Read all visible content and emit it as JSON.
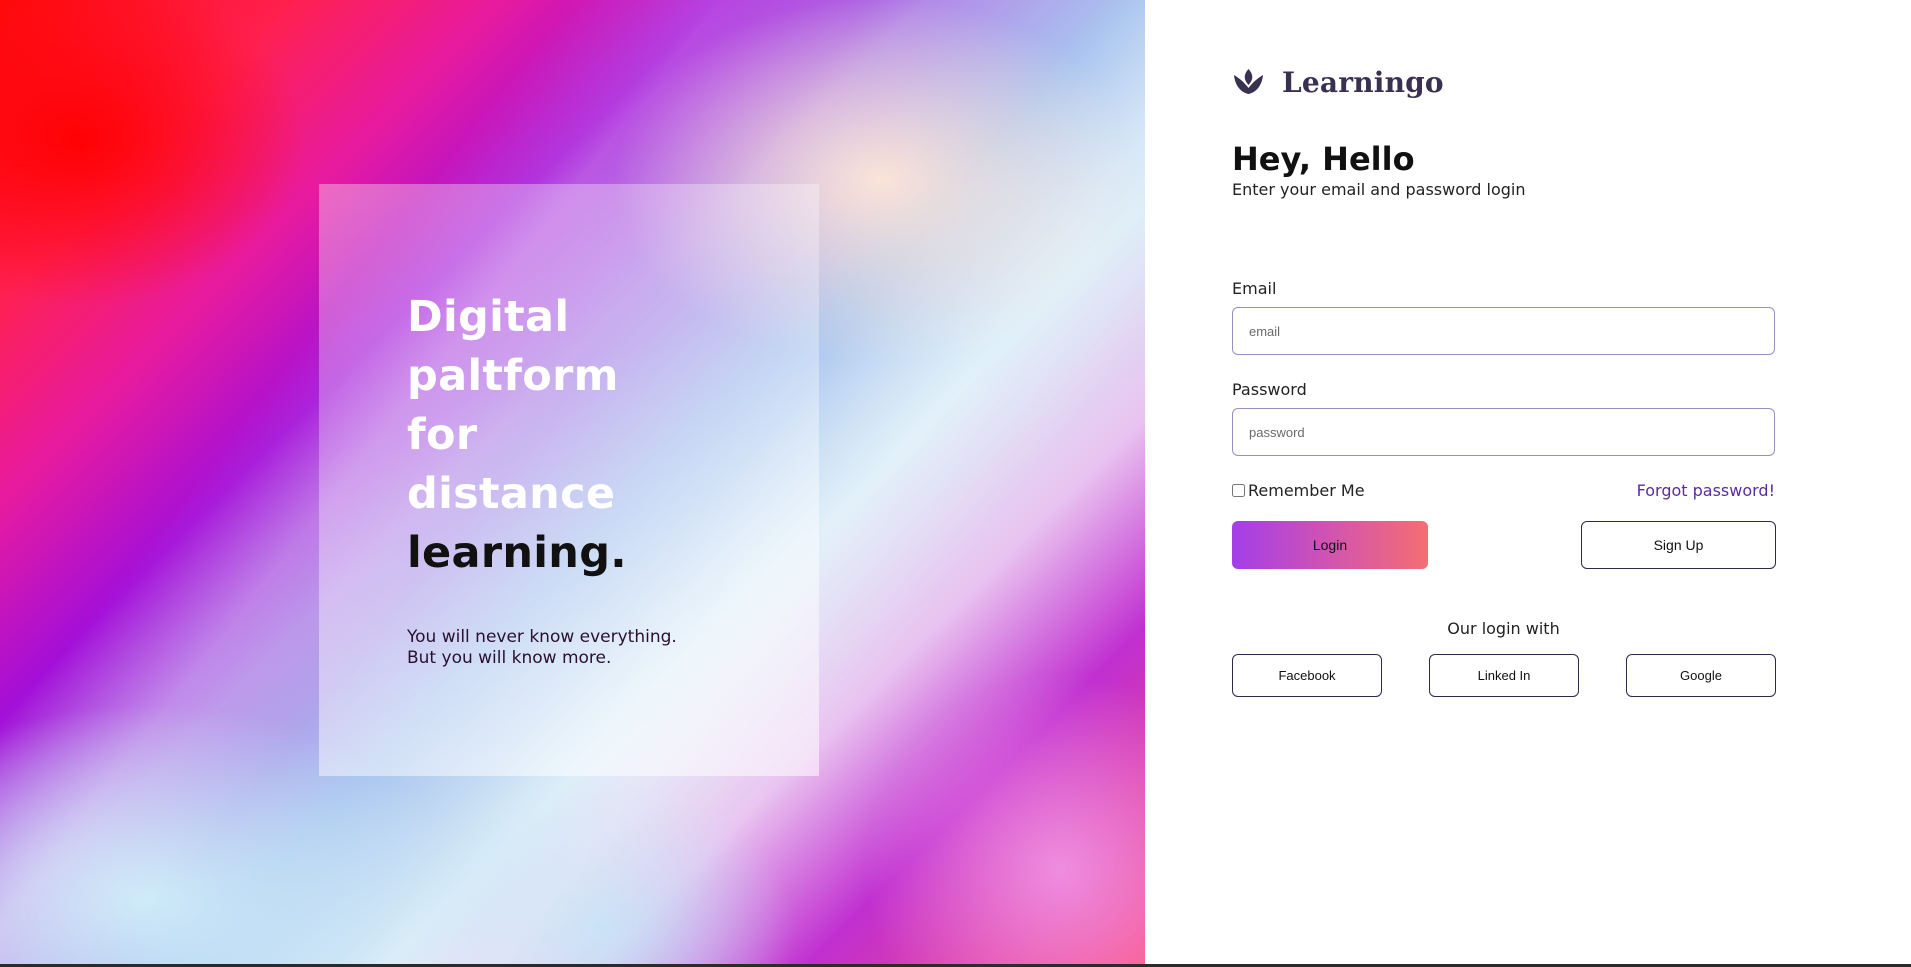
{
  "hero": {
    "title_lines": [
      "Digital",
      "paltform",
      "for",
      "distance"
    ],
    "title_emphasis": "learning.",
    "subtitle_lines": [
      "You will never know everything.",
      "But you will know more."
    ]
  },
  "brand": {
    "name": "Learningo",
    "icon": "lotus-icon",
    "color": "#3a3050"
  },
  "greeting": {
    "title": "Hey, Hello",
    "subtitle": "Enter your email and password login"
  },
  "form": {
    "email": {
      "label": "Email",
      "placeholder": "email",
      "value": ""
    },
    "password": {
      "label": "Password",
      "placeholder": "password",
      "value": ""
    },
    "remember_label": "Remember Me",
    "remember_checked": false,
    "forgot_label": "Forgot password!",
    "login_label": "Login",
    "signup_label": "Sign Up"
  },
  "social": {
    "title": "Our login with",
    "buttons": [
      "Facebook",
      "Linked In",
      "Google"
    ]
  },
  "colors": {
    "accent_link": "#5b2ba0",
    "login_gradient_start": "#a33ee8",
    "login_gradient_end": "#f46e72",
    "input_border": "#9b8fc0"
  }
}
